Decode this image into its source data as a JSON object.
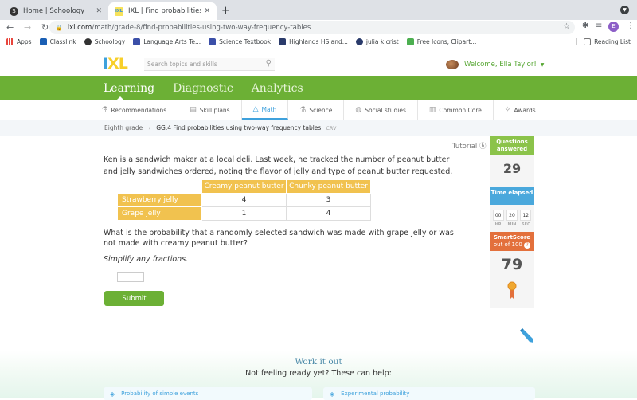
{
  "browser": {
    "tabs": [
      {
        "label": "Home | Schoology",
        "icon": "schoology-icon",
        "active": false
      },
      {
        "label": "IXL | Find probabilities using tw",
        "icon": "ixl-icon",
        "active": true
      }
    ],
    "url_domain": "ixl.com",
    "url_path": "/math/grade-8/find-probabilities-using-two-way-frequency-tables",
    "profile_initial": "E",
    "bookmarks": [
      {
        "label": "Apps",
        "color": "#e8453c"
      },
      {
        "label": "Classlink",
        "color": "#1a5fb4"
      },
      {
        "label": "Schoology",
        "color": "#333333"
      },
      {
        "label": "Language Arts Te...",
        "color": "#3b4fa8"
      },
      {
        "label": "Science Textbook",
        "color": "#3b4fa8"
      },
      {
        "label": "Highlands HS and...",
        "color": "#2a3b6b"
      },
      {
        "label": "julia k crist",
        "color": "#2a3b6b"
      },
      {
        "label": "Free Icons, Clipart...",
        "color": "#4caf50"
      }
    ],
    "reading_list": "Reading List"
  },
  "header": {
    "logo": {
      "i": "I",
      "x": "X",
      "l": "L"
    },
    "search_placeholder": "Search topics and skills",
    "welcome": "Welcome, Ella Taylor!"
  },
  "main_nav": [
    {
      "label": "Learning",
      "active": true
    },
    {
      "label": "Diagnostic",
      "active": false
    },
    {
      "label": "Analytics",
      "active": false
    }
  ],
  "sub_nav": [
    {
      "label": "Recommendations",
      "icon": "recommendations-icon"
    },
    {
      "label": "Skill plans",
      "icon": "skill-plans-icon"
    },
    {
      "label": "Math",
      "icon": "math-icon",
      "active": true
    },
    {
      "label": "Science",
      "icon": "science-icon"
    },
    {
      "label": "Social studies",
      "icon": "social-studies-icon"
    },
    {
      "label": "Common Core",
      "icon": "common-core-icon"
    },
    {
      "label": "Awards",
      "icon": "awards-icon"
    }
  ],
  "breadcrumb": {
    "grade": "Eighth grade",
    "skill": "GG.4 Find probabilities using two-way frequency tables",
    "code": "CRV"
  },
  "tutorial": "Tutorial",
  "question": {
    "intro": "Ken is a sandwich maker at a local deli. Last week, he tracked the number of peanut butter and jelly sandwiches ordered, noting the flavor of jelly and type of peanut butter requested.",
    "table": {
      "columns": [
        "Creamy peanut butter",
        "Chunky peanut butter"
      ],
      "rows": [
        {
          "label": "Strawberry jelly",
          "values": [
            "4",
            "3"
          ]
        },
        {
          "label": "Grape jelly",
          "values": [
            "1",
            "4"
          ]
        }
      ]
    },
    "prompt": "What is the probability that a randomly selected sandwich was made with grape jelly or was not made with creamy peanut butter?",
    "hint": "Simplify any fractions.",
    "answer_value": "",
    "submit_label": "Submit"
  },
  "sidebar": {
    "questions_label": "Questions answered",
    "questions_value": "29",
    "time_label": "Time elapsed",
    "time": [
      {
        "value": "00",
        "unit": "HR"
      },
      {
        "value": "20",
        "unit": "MIN"
      },
      {
        "value": "12",
        "unit": "SEC"
      }
    ],
    "smartscore_label": "SmartScore",
    "smartscore_sub": "out of 100",
    "smartscore_value": "79"
  },
  "work_it_out": {
    "title": "Work it out",
    "subtitle": "Not feeling ready yet? These can help:",
    "cards": [
      "Probability of simple events",
      "Experimental probability"
    ]
  }
}
